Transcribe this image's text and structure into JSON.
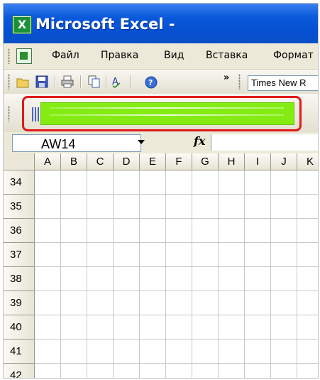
{
  "window": {
    "title": "Microsoft Excel -",
    "app_icon": "excel-icon"
  },
  "menu": {
    "items": [
      "Файл",
      "Правка",
      "Вид",
      "Вставка",
      "Формат"
    ]
  },
  "toolbar": {
    "font_name": "Times New R",
    "more_chevron": "»"
  },
  "highlight": {
    "color": "#84ec13",
    "border_color": "#e01919"
  },
  "formula_bar": {
    "name_box": "AW14",
    "fx_label": "fx",
    "formula": ""
  },
  "grid": {
    "columns": [
      "A",
      "B",
      "C",
      "D",
      "E",
      "F",
      "G",
      "H",
      "I",
      "J",
      "K"
    ],
    "rows": [
      "34",
      "35",
      "36",
      "37",
      "38",
      "39",
      "40",
      "41",
      "42"
    ]
  }
}
